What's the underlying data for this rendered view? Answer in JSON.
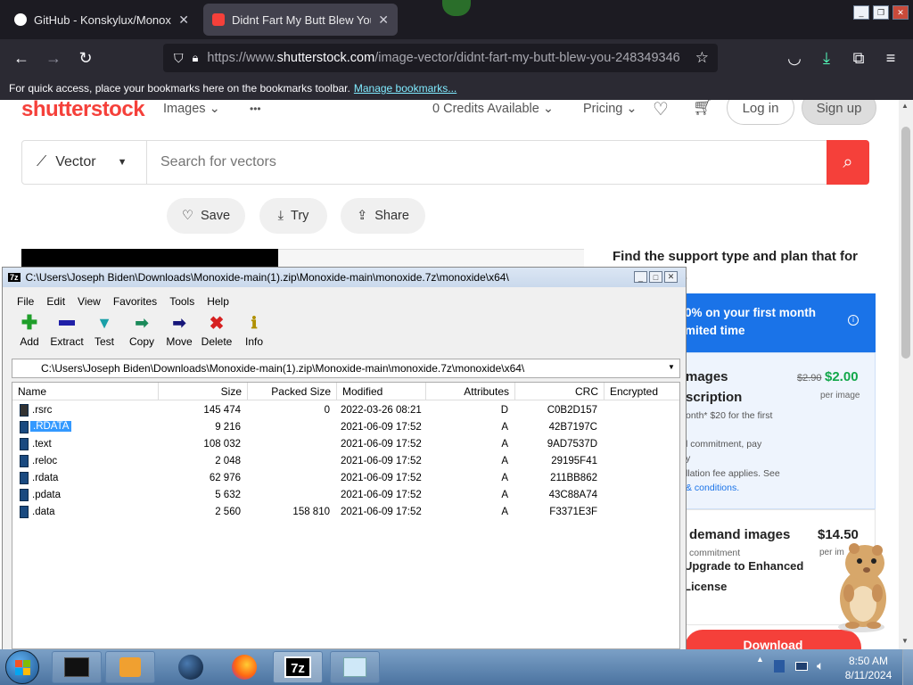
{
  "browser": {
    "tabs": [
      {
        "title": "GitHub - Konskylux/Monoxide",
        "active": false
      },
      {
        "title": "Didnt Fart My Butt Blew You Sto",
        "active": true
      }
    ],
    "url_prefix": "https://www.",
    "url_domain": "shutterstock.com",
    "url_path": "/image-vector/didnt-fart-my-butt-blew-you-248349346",
    "bookmarks_text": "For quick access, place your bookmarks here on the bookmarks toolbar.",
    "bookmarks_link": "Manage bookmarks..."
  },
  "shutterstock": {
    "logo": "shutterstock",
    "nav_images": "Images",
    "nav_more": "•••",
    "credits": "0 Credits Available",
    "pricing": "Pricing",
    "login": "Log in",
    "signup": "Sign up",
    "search_type": "Vector",
    "search_placeholder": "Search for vectors",
    "save": "Save",
    "try": "Try",
    "share": "Share",
    "panel_heading": "Find the support type and plan that for your needs.",
    "promo_line1": "0% on your first month",
    "promo_line2": "mited time",
    "sub_title1": "mages",
    "sub_title2": "scription",
    "sub_old_price": "$2.90",
    "sub_price": "$2.00",
    "sub_per": "per image",
    "sub_note": "onth* $20 for the first",
    "sub_commit1": "l commitment, pay",
    "sub_commit2": "y",
    "sub_cancel": "llation fee applies. See",
    "sub_terms": "& conditions.",
    "ondemand_title": "demand images",
    "ondemand_price": "$14.50",
    "ondemand_commit": "commitment",
    "ondemand_per": "per im",
    "upgrade1": "Upgrade to Enhanced",
    "upgrade2": "License",
    "download": "Download"
  },
  "zip": {
    "title": "C:\\Users\\Joseph Biden\\Downloads\\Monoxide-main(1).zip\\Monoxide-main\\monoxide.7z\\monoxide\\x64\\",
    "menu": [
      "File",
      "Edit",
      "View",
      "Favorites",
      "Tools",
      "Help"
    ],
    "tools": [
      "Add",
      "Extract",
      "Test",
      "Copy",
      "Move",
      "Delete",
      "Info"
    ],
    "address": "C:\\Users\\Joseph Biden\\Downloads\\Monoxide-main(1).zip\\Monoxide-main\\monoxide.7z\\monoxide\\x64\\",
    "columns": [
      "Name",
      "Size",
      "Packed Size",
      "Modified",
      "Attributes",
      "CRC",
      "Encrypted"
    ],
    "rows": [
      {
        "name": ".rsrc",
        "size": "145 474",
        "packed": "0",
        "modified": "2022-03-26 08:21",
        "attr": "D",
        "crc": "C0B2D157"
      },
      {
        "name": ".RDATA",
        "size": "9 216",
        "packed": "",
        "modified": "2021-06-09 17:52",
        "attr": "A",
        "crc": "42B7197C"
      },
      {
        "name": ".text",
        "size": "108 032",
        "packed": "",
        "modified": "2021-06-09 17:52",
        "attr": "A",
        "crc": "9AD7537D"
      },
      {
        "name": ".reloc",
        "size": "2 048",
        "packed": "",
        "modified": "2021-06-09 17:52",
        "attr": "A",
        "crc": "29195F41"
      },
      {
        "name": ".rdata",
        "size": "62 976",
        "packed": "",
        "modified": "2021-06-09 17:52",
        "attr": "A",
        "crc": "211BB862"
      },
      {
        "name": ".pdata",
        "size": "5 632",
        "packed": "",
        "modified": "2021-06-09 17:52",
        "attr": "A",
        "crc": "43C88A74"
      },
      {
        "name": ".data",
        "size": "2 560",
        "packed": "158 810",
        "modified": "2021-06-09 17:52",
        "attr": "A",
        "crc": "F3371E3F"
      }
    ]
  },
  "taskbar": {
    "time": "8:50 AM",
    "date": "8/11/2024",
    "zip_label": "7z"
  }
}
